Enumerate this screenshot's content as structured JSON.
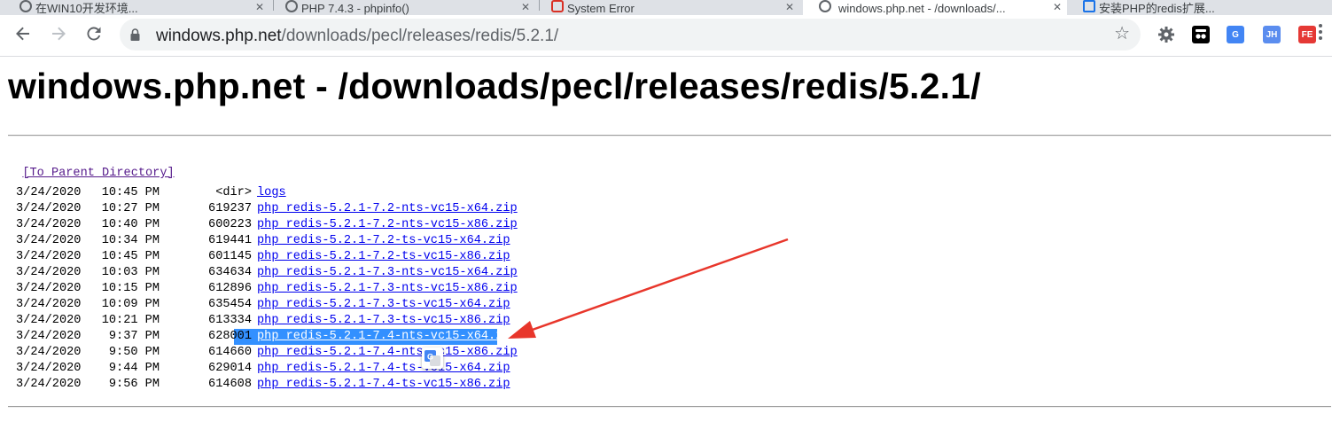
{
  "browser": {
    "tabs": [
      {
        "title": "在WIN10开发环境...",
        "active": false
      },
      {
        "title": "PHP 7.4.3 - phpinfo()",
        "active": false
      },
      {
        "title": "System Error",
        "active": false
      },
      {
        "title": "windows.php.net - /downloads/...",
        "active": true
      },
      {
        "title": "安装PHP的redis扩展...",
        "active": false
      }
    ],
    "url_host": "windows.php.net",
    "url_path": "/downloads/pecl/releases/redis/5.2.1/",
    "extensions": [
      {
        "icon": "gear-extension-icon",
        "label": ""
      },
      {
        "icon": "tampermonkey-icon",
        "label": ""
      },
      {
        "icon": "google-translate-icon",
        "label": "G"
      },
      {
        "icon": "jh-extension-icon",
        "label": "JH"
      },
      {
        "icon": "fe-helper-icon",
        "label": "FE"
      }
    ]
  },
  "page": {
    "heading": "windows.php.net - /downloads/pecl/releases/redis/5.2.1/",
    "parent_link": "[To Parent Directory]",
    "files": [
      {
        "date": "3/24/2020",
        "time": "10:45 PM",
        "size": "<dir>",
        "name": "logs"
      },
      {
        "date": "3/24/2020",
        "time": "10:27 PM",
        "size": "619237",
        "name": "php_redis-5.2.1-7.2-nts-vc15-x64.zip"
      },
      {
        "date": "3/24/2020",
        "time": "10:40 PM",
        "size": "600223",
        "name": "php_redis-5.2.1-7.2-nts-vc15-x86.zip"
      },
      {
        "date": "3/24/2020",
        "time": "10:34 PM",
        "size": "619441",
        "name": "php_redis-5.2.1-7.2-ts-vc15-x64.zip"
      },
      {
        "date": "3/24/2020",
        "time": "10:45 PM",
        "size": "601145",
        "name": "php_redis-5.2.1-7.2-ts-vc15-x86.zip"
      },
      {
        "date": "3/24/2020",
        "time": "10:03 PM",
        "size": "634634",
        "name": "php_redis-5.2.1-7.3-nts-vc15-x64.zip"
      },
      {
        "date": "3/24/2020",
        "time": "10:15 PM",
        "size": "612896",
        "name": "php_redis-5.2.1-7.3-nts-vc15-x86.zip"
      },
      {
        "date": "3/24/2020",
        "time": "10:09 PM",
        "size": "635454",
        "name": "php_redis-5.2.1-7.3-ts-vc15-x64.zip"
      },
      {
        "date": "3/24/2020",
        "time": "10:21 PM",
        "size": "613334",
        "name": "php_redis-5.2.1-7.3-ts-vc15-x86.zip"
      },
      {
        "date": "3/24/2020",
        "time": "9:37 PM",
        "size": "628001",
        "name": "php_redis-5.2.1-7.4-nts-vc15-x64.zip"
      },
      {
        "date": "3/24/2020",
        "time": "9:50 PM",
        "size": "614660",
        "name": "php_redis-5.2.1-7.4-nts-vc15-x86.zip"
      },
      {
        "date": "3/24/2020",
        "time": "9:44 PM",
        "size": "629014",
        "name": "php_redis-5.2.1-7.4-ts-vc15-x64.zip"
      },
      {
        "date": "3/24/2020",
        "time": "9:56 PM",
        "size": "614608",
        "name": "php_redis-5.2.1-7.4-ts-vc15-x86.zip"
      }
    ],
    "selected_file": "php_redis-5.2.1-7.4-nts-vc15-x64.zip"
  },
  "annotation": {
    "icon": "red-arrow-annotation",
    "color": "#e8362b"
  }
}
